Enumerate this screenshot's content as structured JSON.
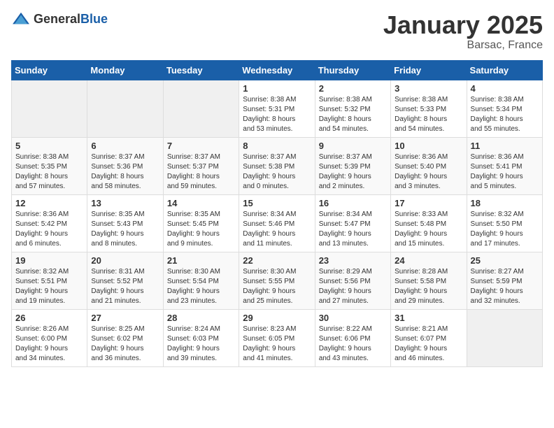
{
  "header": {
    "logo_general": "General",
    "logo_blue": "Blue",
    "month_title": "January 2025",
    "location": "Barsac, France"
  },
  "calendar": {
    "days_of_week": [
      "Sunday",
      "Monday",
      "Tuesday",
      "Wednesday",
      "Thursday",
      "Friday",
      "Saturday"
    ],
    "weeks": [
      [
        {
          "day": "",
          "info": ""
        },
        {
          "day": "",
          "info": ""
        },
        {
          "day": "",
          "info": ""
        },
        {
          "day": "1",
          "info": "Sunrise: 8:38 AM\nSunset: 5:31 PM\nDaylight: 8 hours\nand 53 minutes."
        },
        {
          "day": "2",
          "info": "Sunrise: 8:38 AM\nSunset: 5:32 PM\nDaylight: 8 hours\nand 54 minutes."
        },
        {
          "day": "3",
          "info": "Sunrise: 8:38 AM\nSunset: 5:33 PM\nDaylight: 8 hours\nand 54 minutes."
        },
        {
          "day": "4",
          "info": "Sunrise: 8:38 AM\nSunset: 5:34 PM\nDaylight: 8 hours\nand 55 minutes."
        }
      ],
      [
        {
          "day": "5",
          "info": "Sunrise: 8:38 AM\nSunset: 5:35 PM\nDaylight: 8 hours\nand 57 minutes."
        },
        {
          "day": "6",
          "info": "Sunrise: 8:37 AM\nSunset: 5:36 PM\nDaylight: 8 hours\nand 58 minutes."
        },
        {
          "day": "7",
          "info": "Sunrise: 8:37 AM\nSunset: 5:37 PM\nDaylight: 8 hours\nand 59 minutes."
        },
        {
          "day": "8",
          "info": "Sunrise: 8:37 AM\nSunset: 5:38 PM\nDaylight: 9 hours\nand 0 minutes."
        },
        {
          "day": "9",
          "info": "Sunrise: 8:37 AM\nSunset: 5:39 PM\nDaylight: 9 hours\nand 2 minutes."
        },
        {
          "day": "10",
          "info": "Sunrise: 8:36 AM\nSunset: 5:40 PM\nDaylight: 9 hours\nand 3 minutes."
        },
        {
          "day": "11",
          "info": "Sunrise: 8:36 AM\nSunset: 5:41 PM\nDaylight: 9 hours\nand 5 minutes."
        }
      ],
      [
        {
          "day": "12",
          "info": "Sunrise: 8:36 AM\nSunset: 5:42 PM\nDaylight: 9 hours\nand 6 minutes."
        },
        {
          "day": "13",
          "info": "Sunrise: 8:35 AM\nSunset: 5:43 PM\nDaylight: 9 hours\nand 8 minutes."
        },
        {
          "day": "14",
          "info": "Sunrise: 8:35 AM\nSunset: 5:45 PM\nDaylight: 9 hours\nand 9 minutes."
        },
        {
          "day": "15",
          "info": "Sunrise: 8:34 AM\nSunset: 5:46 PM\nDaylight: 9 hours\nand 11 minutes."
        },
        {
          "day": "16",
          "info": "Sunrise: 8:34 AM\nSunset: 5:47 PM\nDaylight: 9 hours\nand 13 minutes."
        },
        {
          "day": "17",
          "info": "Sunrise: 8:33 AM\nSunset: 5:48 PM\nDaylight: 9 hours\nand 15 minutes."
        },
        {
          "day": "18",
          "info": "Sunrise: 8:32 AM\nSunset: 5:50 PM\nDaylight: 9 hours\nand 17 minutes."
        }
      ],
      [
        {
          "day": "19",
          "info": "Sunrise: 8:32 AM\nSunset: 5:51 PM\nDaylight: 9 hours\nand 19 minutes."
        },
        {
          "day": "20",
          "info": "Sunrise: 8:31 AM\nSunset: 5:52 PM\nDaylight: 9 hours\nand 21 minutes."
        },
        {
          "day": "21",
          "info": "Sunrise: 8:30 AM\nSunset: 5:54 PM\nDaylight: 9 hours\nand 23 minutes."
        },
        {
          "day": "22",
          "info": "Sunrise: 8:30 AM\nSunset: 5:55 PM\nDaylight: 9 hours\nand 25 minutes."
        },
        {
          "day": "23",
          "info": "Sunrise: 8:29 AM\nSunset: 5:56 PM\nDaylight: 9 hours\nand 27 minutes."
        },
        {
          "day": "24",
          "info": "Sunrise: 8:28 AM\nSunset: 5:58 PM\nDaylight: 9 hours\nand 29 minutes."
        },
        {
          "day": "25",
          "info": "Sunrise: 8:27 AM\nSunset: 5:59 PM\nDaylight: 9 hours\nand 32 minutes."
        }
      ],
      [
        {
          "day": "26",
          "info": "Sunrise: 8:26 AM\nSunset: 6:00 PM\nDaylight: 9 hours\nand 34 minutes."
        },
        {
          "day": "27",
          "info": "Sunrise: 8:25 AM\nSunset: 6:02 PM\nDaylight: 9 hours\nand 36 minutes."
        },
        {
          "day": "28",
          "info": "Sunrise: 8:24 AM\nSunset: 6:03 PM\nDaylight: 9 hours\nand 39 minutes."
        },
        {
          "day": "29",
          "info": "Sunrise: 8:23 AM\nSunset: 6:05 PM\nDaylight: 9 hours\nand 41 minutes."
        },
        {
          "day": "30",
          "info": "Sunrise: 8:22 AM\nSunset: 6:06 PM\nDaylight: 9 hours\nand 43 minutes."
        },
        {
          "day": "31",
          "info": "Sunrise: 8:21 AM\nSunset: 6:07 PM\nDaylight: 9 hours\nand 46 minutes."
        },
        {
          "day": "",
          "info": ""
        }
      ]
    ]
  }
}
